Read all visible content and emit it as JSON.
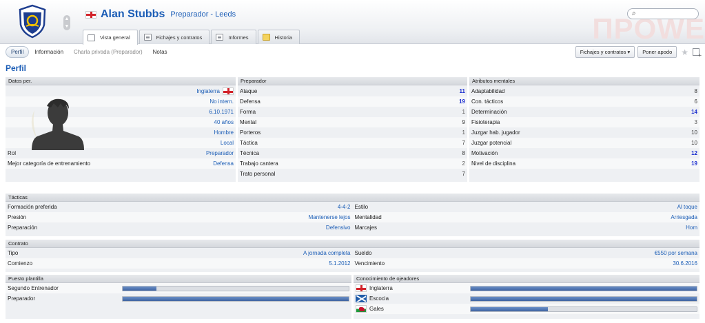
{
  "header": {
    "name": "Alan Stubbs",
    "role_club": "Preparador - Leeds",
    "watermark": "ΠPOWE",
    "search_value": ""
  },
  "tabs": [
    {
      "label": "Vista general",
      "icon": "overview-icon",
      "active": true
    },
    {
      "label": "Fichajes y contratos",
      "icon": "contracts-icon",
      "active": false
    },
    {
      "label": "Informes",
      "icon": "reports-icon",
      "active": false
    },
    {
      "label": "Historia",
      "icon": "history-icon",
      "active": false
    }
  ],
  "subnav": {
    "perfil": "Perfil",
    "informacion": "Información",
    "charla": "Charla privada (Preparador)",
    "notas": "Notas",
    "fichajes_btn": "Fichajes y contratos",
    "apodo_btn": "Poner apodo"
  },
  "page_title": "Perfil",
  "datos": {
    "header": "Datos per.",
    "nationality": "Inglaterra",
    "intern": "No intern.",
    "birth": "6.10.1971",
    "age": "40 años",
    "gender": "Hombre",
    "origin": "Local",
    "rol_label": "Rol",
    "rol_value": "Preparador",
    "cat_label": "Mejor categoría de entrenamiento",
    "cat_value": "Defensa"
  },
  "preparador": {
    "header": "Preparador",
    "rows": [
      {
        "label": "Ataque",
        "value": "11",
        "hi": true
      },
      {
        "label": "Defensa",
        "value": "19",
        "hi": true
      },
      {
        "label": "Forma",
        "value": "1",
        "hi": false
      },
      {
        "label": "Mental",
        "value": "9",
        "hi": false
      },
      {
        "label": "Porteros",
        "value": "1",
        "hi": false
      },
      {
        "label": "Táctica",
        "value": "7",
        "hi": false
      },
      {
        "label": "Técnica",
        "value": "8",
        "hi": false
      },
      {
        "label": "Trabajo cantera",
        "value": "2",
        "hi": false
      },
      {
        "label": "Trato personal",
        "value": "7",
        "hi": false
      }
    ]
  },
  "mentales": {
    "header": "Atributos mentales",
    "rows": [
      {
        "label": "Adaptabilidad",
        "value": "8",
        "hi": false
      },
      {
        "label": "Con. tácticos",
        "value": "6",
        "hi": false
      },
      {
        "label": "Determinación",
        "value": "14",
        "hi": true
      },
      {
        "label": "Fisioterapia",
        "value": "3",
        "hi": false
      },
      {
        "label": "Juzgar hab. jugador",
        "value": "10",
        "hi": false
      },
      {
        "label": "Juzgar potencial",
        "value": "10",
        "hi": false
      },
      {
        "label": "Motivación",
        "value": "12",
        "hi": true
      },
      {
        "label": "Nivel de disciplina",
        "value": "19",
        "hi": true
      }
    ]
  },
  "tacticas": {
    "header": "Tácticas",
    "left": [
      {
        "label": "Formación preferida",
        "value": "4-4-2"
      },
      {
        "label": "Presión",
        "value": "Mantenerse lejos"
      },
      {
        "label": "Preparación",
        "value": "Defensivo"
      }
    ],
    "right": [
      {
        "label": "Estilo",
        "value": "Al toque"
      },
      {
        "label": "Mentalidad",
        "value": "Arriesgada"
      },
      {
        "label": "Marcajes",
        "value": "Hom"
      }
    ]
  },
  "contrato": {
    "header": "Contrato",
    "left": [
      {
        "label": "Tipo",
        "value": "A jornada completa"
      },
      {
        "label": "Comienzo",
        "value": "5.1.2012"
      }
    ],
    "right": [
      {
        "label": "Sueldo",
        "value": "€550 por semana"
      },
      {
        "label": "Vencimiento",
        "value": "30.6.2016"
      }
    ]
  },
  "puesto": {
    "header": "Puesto plantilla",
    "rows": [
      {
        "label": "Segundo Entrenador",
        "fill": 0.15
      },
      {
        "label": "Preparador",
        "fill": 1.0
      }
    ]
  },
  "ojeadores": {
    "header": "Conocimiento de ojeadores",
    "rows": [
      {
        "label": "Inglaterra",
        "flag": "eng",
        "fill": 1.0
      },
      {
        "label": "Escocia",
        "flag": "sco",
        "fill": 1.0
      },
      {
        "label": "Gales",
        "flag": "wal",
        "fill": 0.34
      }
    ]
  },
  "colors": {
    "accent": "#1b5db6",
    "high_value": "#1b2ecf",
    "bar_fill": "#3e63a1"
  }
}
